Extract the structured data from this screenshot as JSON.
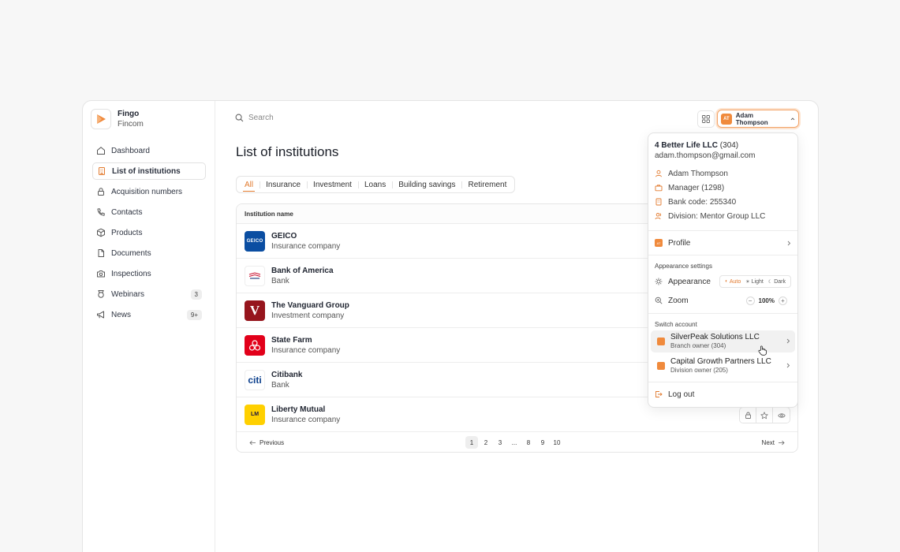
{
  "brand": {
    "name": "Fingo",
    "subtitle": "Fincom",
    "accent": "#f08a3c"
  },
  "nav": [
    {
      "label": "Dashboard",
      "icon": "home-icon",
      "active": false
    },
    {
      "label": "List of institutions",
      "icon": "building-icon",
      "active": true
    },
    {
      "label": "Acquisition numbers",
      "icon": "lock-icon",
      "active": false
    },
    {
      "label": "Contacts",
      "icon": "phone-icon",
      "active": false
    },
    {
      "label": "Products",
      "icon": "box-icon",
      "active": false
    },
    {
      "label": "Documents",
      "icon": "document-icon",
      "active": false
    },
    {
      "label": "Inspections",
      "icon": "camera-icon",
      "active": false
    },
    {
      "label": "Webinars",
      "icon": "award-icon",
      "active": false,
      "badge": "3"
    },
    {
      "label": "News",
      "icon": "megaphone-icon",
      "active": false,
      "badge": "9+"
    }
  ],
  "search": {
    "placeholder": "Search"
  },
  "user": {
    "initials": "AT",
    "name": "Adam Thompson"
  },
  "page": {
    "title": "List of institutions"
  },
  "tabs": [
    "All",
    "Insurance",
    "Investment",
    "Loans",
    "Building savings",
    "Retirement"
  ],
  "table": {
    "header": "Institution name",
    "rows": [
      {
        "name": "GEICO",
        "type": "Insurance company",
        "logo": "GEICO"
      },
      {
        "name": "Bank of America",
        "type": "Bank",
        "logo": "BofA"
      },
      {
        "name": "The Vanguard Group",
        "type": "Investment company",
        "logo": "V"
      },
      {
        "name": "State Farm",
        "type": "Insurance company",
        "logo": "SF"
      },
      {
        "name": "Citibank",
        "type": "Bank",
        "logo": "citi"
      },
      {
        "name": "Liberty Mutual",
        "type": "Insurance company",
        "logo": "LM"
      }
    ]
  },
  "pagination": {
    "prev": "Previous",
    "next": "Next",
    "pages": [
      "1",
      "2",
      "3",
      "...",
      "8",
      "9",
      "10"
    ],
    "current": "1"
  },
  "menu": {
    "org": "4 Better Life LLC",
    "org_count": "(304)",
    "email": "adam.thompson@gmail.com",
    "info": [
      {
        "icon": "user-icon",
        "text": "Adam Thompson"
      },
      {
        "icon": "briefcase-icon",
        "text": "Manager (1298)"
      },
      {
        "icon": "building-icon",
        "text": "Bank code: 255340"
      },
      {
        "icon": "users-icon",
        "text": "Division: Mentor Group LLC"
      }
    ],
    "profile": "Profile",
    "appearance_settings": "Appearance settings",
    "appearance": "Appearance",
    "appearance_options": [
      "Auto",
      "Light",
      "Dark"
    ],
    "appearance_selected": "Auto",
    "zoom": "Zoom",
    "zoom_value": "100%",
    "switch_account": "Switch account",
    "accounts": [
      {
        "name": "SilverPeak Solutions LLC",
        "role": "Branch owner (304)"
      },
      {
        "name": "Capital Growth Partners LLC",
        "role": "Division owner (205)"
      }
    ],
    "logout": "Log out"
  }
}
